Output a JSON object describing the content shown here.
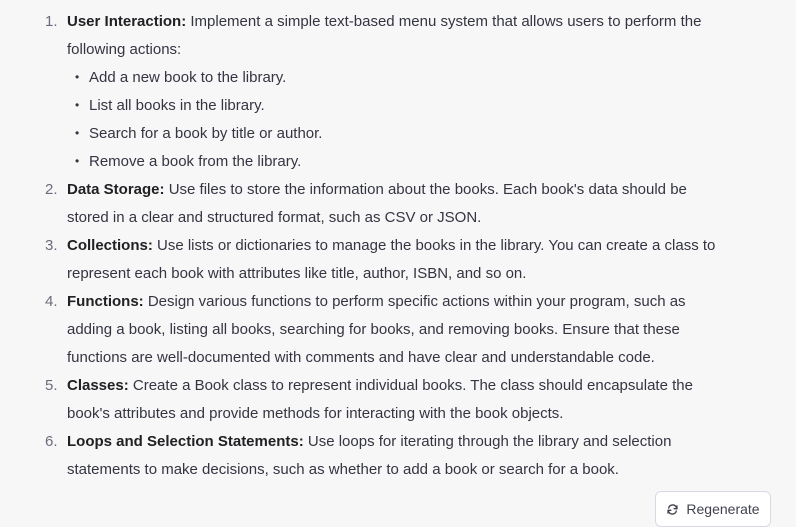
{
  "items": [
    {
      "number": "1.",
      "title": "User Interaction:",
      "text": " Implement a simple text-based menu system that allows users to perform the following actions:",
      "subitems": [
        "Add a new book to the library.",
        "List all books in the library.",
        "Search for a book by title or author.",
        "Remove a book from the library."
      ]
    },
    {
      "number": "2.",
      "title": "Data Storage:",
      "text": " Use files to store the information about the books. Each book's data should be stored in a clear and structured format, such as CSV or JSON."
    },
    {
      "number": "3.",
      "title": "Collections:",
      "text": " Use lists or dictionaries to manage the books in the library. You can create a class to represent each book with attributes like title, author, ISBN, and so on."
    },
    {
      "number": "4.",
      "title": "Functions:",
      "text": " Design various functions to perform specific actions within your program, such as adding a book, listing all books, searching for books, and removing books. Ensure that these functions are well-documented with comments and have clear and understandable code."
    },
    {
      "number": "5.",
      "title": "Classes:",
      "text": " Create a Book class to represent individual books. The class should encapsulate the book's attributes and provide methods for interacting with the book objects."
    },
    {
      "number": "6.",
      "title": "Loops and Selection Statements:",
      "text": " Use loops for iterating through the library and selection statements to make decisions, such as whether to add a book or search for a book."
    }
  ],
  "regenerate": {
    "label": "Regenerate",
    "icon": "refresh-icon"
  }
}
